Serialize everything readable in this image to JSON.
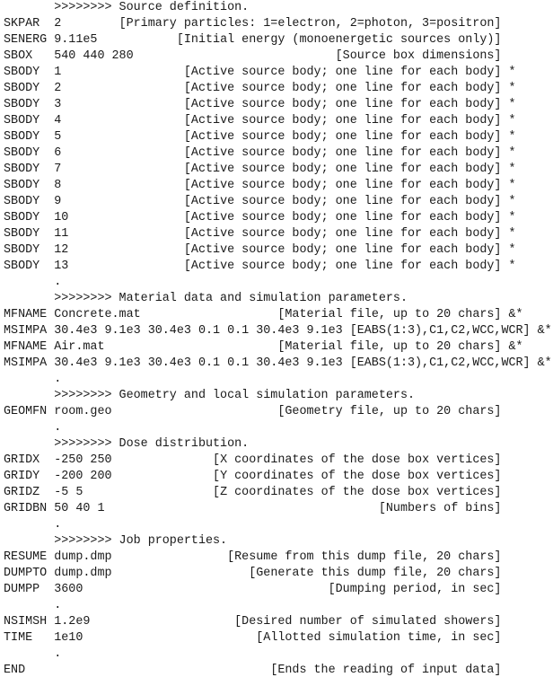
{
  "lines": [
    {
      "type": "header",
      "text": ">>>>>>>> Source definition."
    },
    {
      "type": "entry",
      "kw": "SKPAR",
      "val": "2",
      "comment": "[Primary particles: 1=electron, 2=photon, 3=positron]"
    },
    {
      "type": "entry",
      "kw": "SENERG",
      "val": "9.11e5",
      "comment": "[Initial energy (monoenergetic sources only)]"
    },
    {
      "type": "entry",
      "kw": "SBOX",
      "val": "540 440 280",
      "comment": "[Source box dimensions]"
    },
    {
      "type": "entry",
      "kw": "SBODY",
      "val": "1",
      "comment": "[Active source body; one line for each body]",
      "flag": "*"
    },
    {
      "type": "entry",
      "kw": "SBODY",
      "val": "2",
      "comment": "[Active source body; one line for each body]",
      "flag": "*"
    },
    {
      "type": "entry",
      "kw": "SBODY",
      "val": "3",
      "comment": "[Active source body; one line for each body]",
      "flag": "*"
    },
    {
      "type": "entry",
      "kw": "SBODY",
      "val": "4",
      "comment": "[Active source body; one line for each body]",
      "flag": "*"
    },
    {
      "type": "entry",
      "kw": "SBODY",
      "val": "5",
      "comment": "[Active source body; one line for each body]",
      "flag": "*"
    },
    {
      "type": "entry",
      "kw": "SBODY",
      "val": "6",
      "comment": "[Active source body; one line for each body]",
      "flag": "*"
    },
    {
      "type": "entry",
      "kw": "SBODY",
      "val": "7",
      "comment": "[Active source body; one line for each body]",
      "flag": "*"
    },
    {
      "type": "entry",
      "kw": "SBODY",
      "val": "8",
      "comment": "[Active source body; one line for each body]",
      "flag": "*"
    },
    {
      "type": "entry",
      "kw": "SBODY",
      "val": "9",
      "comment": "[Active source body; one line for each body]",
      "flag": "*"
    },
    {
      "type": "entry",
      "kw": "SBODY",
      "val": "10",
      "comment": "[Active source body; one line for each body]",
      "flag": "*"
    },
    {
      "type": "entry",
      "kw": "SBODY",
      "val": "11",
      "comment": "[Active source body; one line for each body]",
      "flag": "*"
    },
    {
      "type": "entry",
      "kw": "SBODY",
      "val": "12",
      "comment": "[Active source body; one line for each body]",
      "flag": "*"
    },
    {
      "type": "entry",
      "kw": "SBODY",
      "val": "13",
      "comment": "[Active source body; one line for each body]",
      "flag": "*"
    },
    {
      "type": "header",
      "text": "."
    },
    {
      "type": "header",
      "text": ">>>>>>>> Material data and simulation parameters."
    },
    {
      "type": "entry",
      "kw": "MFNAME",
      "val": "Concrete.mat",
      "comment": "[Material file, up to 20 chars]",
      "flag": "&*"
    },
    {
      "type": "entry",
      "kw": "MSIMPA",
      "val": "30.4e3 9.1e3 30.4e3 0.1 0.1 30.4e3 9.1e3",
      "comment": "[EABS(1:3),C1,C2,WCC,WCR]",
      "flag": "&*",
      "wide": true
    },
    {
      "type": "entry",
      "kw": "MFNAME",
      "val": "Air.mat",
      "comment": "[Material file, up to 20 chars]",
      "flag": "&*"
    },
    {
      "type": "entry",
      "kw": "MSIMPA",
      "val": "30.4e3 9.1e3 30.4e3 0.1 0.1 30.4e3 9.1e3",
      "comment": "[EABS(1:3),C1,C2,WCC,WCR]",
      "flag": "&*",
      "wide": true
    },
    {
      "type": "header",
      "text": "."
    },
    {
      "type": "header",
      "text": ">>>>>>>> Geometry and local simulation parameters."
    },
    {
      "type": "entry",
      "kw": "GEOMFN",
      "val": "room.geo",
      "comment": "[Geometry file, up to 20 chars]"
    },
    {
      "type": "header",
      "text": "."
    },
    {
      "type": "header",
      "text": ">>>>>>>> Dose distribution."
    },
    {
      "type": "entry",
      "kw": "GRIDX",
      "val": "-250 250",
      "comment": "[X coordinates of the dose box vertices]"
    },
    {
      "type": "entry",
      "kw": "GRIDY",
      "val": "-200 200",
      "comment": "[Y coordinates of the dose box vertices]"
    },
    {
      "type": "entry",
      "kw": "GRIDZ",
      "val": "-5 5",
      "comment": "[Z coordinates of the dose box vertices]"
    },
    {
      "type": "entry",
      "kw": "GRIDBN",
      "val": "50 40 1",
      "comment": "[Numbers of bins]"
    },
    {
      "type": "header",
      "text": "."
    },
    {
      "type": "header",
      "text": ">>>>>>>> Job properties."
    },
    {
      "type": "entry",
      "kw": "RESUME",
      "val": "dump.dmp",
      "comment": "[Resume from this dump file, 20 chars]"
    },
    {
      "type": "entry",
      "kw": "DUMPTO",
      "val": "dump.dmp",
      "comment": "[Generate this dump file, 20 chars]"
    },
    {
      "type": "entry",
      "kw": "DUMPP",
      "val": "3600",
      "comment": "[Dumping period, in sec]"
    },
    {
      "type": "header",
      "text": "."
    },
    {
      "type": "entry",
      "kw": "NSIMSH",
      "val": "1.2e9",
      "comment": "[Desired number of simulated showers]"
    },
    {
      "type": "entry",
      "kw": "TIME",
      "val": "1e10",
      "comment": "[Allotted simulation time, in sec]"
    },
    {
      "type": "header",
      "text": "."
    },
    {
      "type": "entry",
      "kw": "END",
      "val": "",
      "comment": "[Ends the reading of input data]"
    }
  ]
}
